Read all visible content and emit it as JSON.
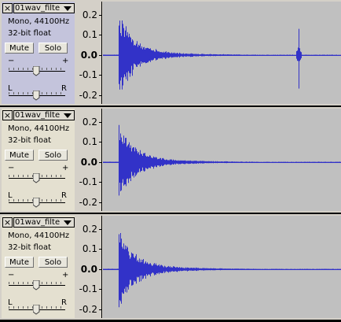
{
  "tracks": [
    {
      "name": "01wav_filte",
      "info_rate": "Mono, 44100Hz",
      "info_format": "32-bit float",
      "mute_label": "Mute",
      "solo_label": "Solo",
      "gain_minus": "−",
      "gain_plus": "+",
      "pan_left": "L",
      "pan_right": "R",
      "selected": true,
      "ticks": [
        "0.2",
        "0.1",
        "0.0",
        "-0.1",
        "-0.2"
      ]
    },
    {
      "name": "01wav_filte",
      "info_rate": "Mono, 44100Hz",
      "info_format": "32-bit float",
      "mute_label": "Mute",
      "solo_label": "Solo",
      "gain_minus": "−",
      "gain_plus": "+",
      "pan_left": "L",
      "pan_right": "R",
      "selected": false,
      "ticks": [
        "0.2",
        "0.1",
        "0.0",
        "-0.1",
        "-0.2"
      ]
    },
    {
      "name": "01wav_filte",
      "info_rate": "Mono, 44100Hz",
      "info_format": "32-bit float",
      "mute_label": "Mute",
      "solo_label": "Solo",
      "gain_minus": "−",
      "gain_plus": "+",
      "pan_left": "L",
      "pan_right": "R",
      "selected": false,
      "ticks": [
        "0.2",
        "0.1",
        "0.0",
        "-0.1",
        "-0.2"
      ]
    }
  ],
  "colors": {
    "waveform": "#3232c8",
    "wave_background": "#c0c0c0",
    "selected_track_panel": "#c4c4dc",
    "track_panel": "#e4e0d0"
  }
}
